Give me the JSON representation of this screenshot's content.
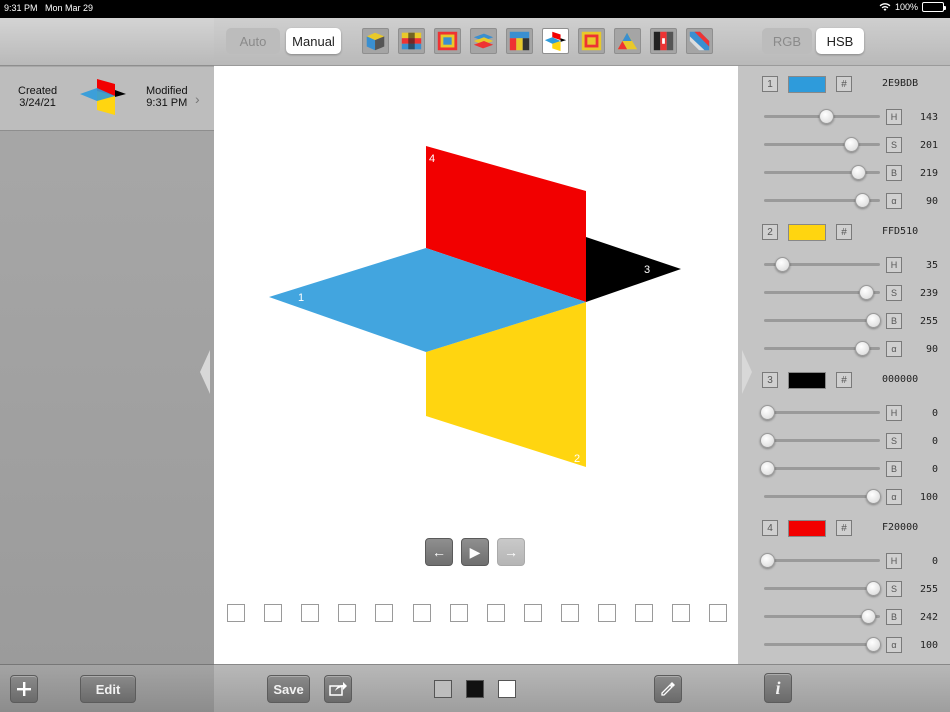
{
  "status_bar": {
    "time": "9:31 PM",
    "date": "Mon Mar 29",
    "battery": "100%"
  },
  "document": {
    "created_label": "Created",
    "created_date": "3/24/21",
    "modified_label": "Modified",
    "modified_time": "9:31 PM"
  },
  "left_toolbar": {
    "add_icon": "plus-icon",
    "edit_label": "Edit"
  },
  "mode_toggle": {
    "auto_label": "Auto",
    "manual_label": "Manual",
    "selected": "Manual"
  },
  "color_model_toggle": {
    "rgb_label": "RGB",
    "hsb_label": "HSB",
    "selected": "HSB"
  },
  "canvas": {
    "planes": [
      {
        "label": "1",
        "color": "#2E9BDB"
      },
      {
        "label": "2",
        "color": "#FFD510"
      },
      {
        "label": "3",
        "color": "#000000"
      },
      {
        "label": "4",
        "color": "#F20000"
      }
    ]
  },
  "playback": {
    "back_icon": "arrow-left-icon",
    "play_icon": "play-icon",
    "forward_icon": "arrow-right-icon"
  },
  "bottom_toolbar": {
    "save_label": "Save",
    "share_icon": "share-icon",
    "background_swatches": [
      "#BDBDBD",
      "#111111",
      "#FFFFFF"
    ],
    "eyedropper_icon": "eyedropper-icon",
    "info_icon": "info-icon"
  },
  "colors": [
    {
      "index": "1",
      "hash": "#",
      "hex": "2E9BDB",
      "swatch": "#2E9BDB",
      "sliders": [
        {
          "label": "H",
          "value": "143",
          "max": 255
        },
        {
          "label": "S",
          "value": "201",
          "max": 255
        },
        {
          "label": "B",
          "value": "219",
          "max": 255
        },
        {
          "label": "α",
          "value": "90",
          "max": 100
        }
      ]
    },
    {
      "index": "2",
      "hash": "#",
      "hex": "FFD510",
      "swatch": "#FFD510",
      "sliders": [
        {
          "label": "H",
          "value": "35",
          "max": 255
        },
        {
          "label": "S",
          "value": "239",
          "max": 255
        },
        {
          "label": "B",
          "value": "255",
          "max": 255
        },
        {
          "label": "α",
          "value": "90",
          "max": 100
        }
      ]
    },
    {
      "index": "3",
      "hash": "#",
      "hex": "000000",
      "swatch": "#000000",
      "sliders": [
        {
          "label": "H",
          "value": "0",
          "max": 255
        },
        {
          "label": "S",
          "value": "0",
          "max": 255
        },
        {
          "label": "B",
          "value": "0",
          "max": 255
        },
        {
          "label": "α",
          "value": "100",
          "max": 100
        }
      ]
    },
    {
      "index": "4",
      "hash": "#",
      "hex": "F20000",
      "swatch": "#F20000",
      "sliders": [
        {
          "label": "H",
          "value": "0",
          "max": 255
        },
        {
          "label": "S",
          "value": "255",
          "max": 255
        },
        {
          "label": "B",
          "value": "242",
          "max": 255
        },
        {
          "label": "α",
          "value": "100",
          "max": 100
        }
      ]
    }
  ]
}
